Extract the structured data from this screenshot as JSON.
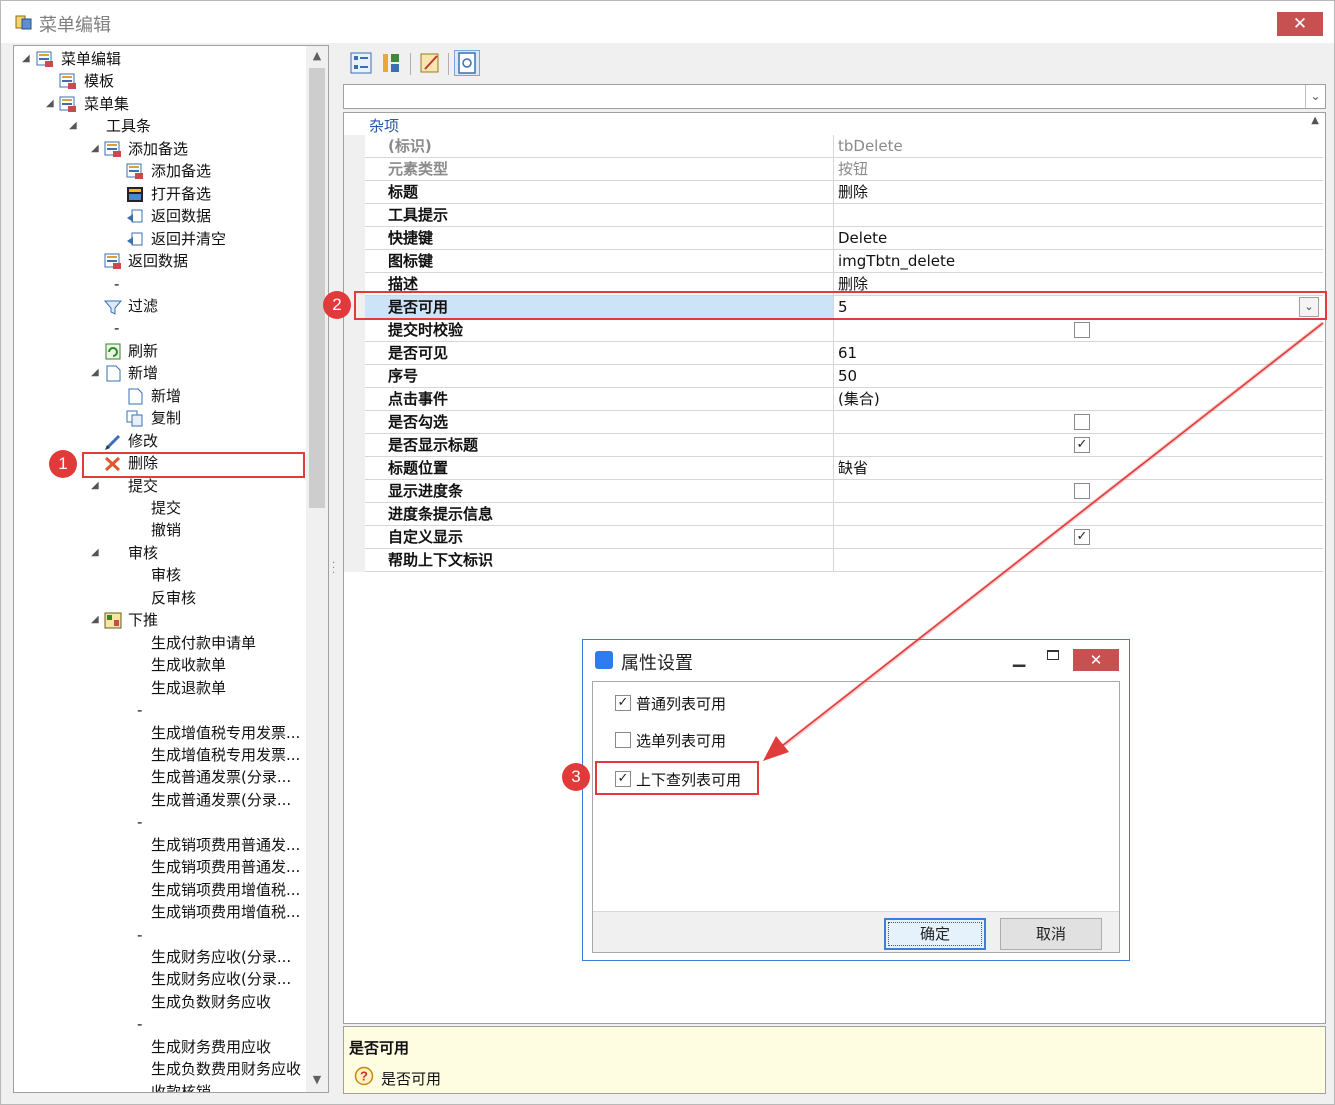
{
  "window": {
    "title": "菜单编辑",
    "close_glyph": "✕"
  },
  "tree": {
    "nodes": [
      {
        "label": "菜单编辑",
        "icon": "menu-editor-icon"
      },
      {
        "label": "模板",
        "icon": "menu-editor-icon"
      },
      {
        "label": "菜单集",
        "icon": "menu-editor-icon"
      },
      {
        "label": "工具条",
        "icon": ""
      },
      {
        "label": "添加备选",
        "icon": "menu-editor-icon"
      },
      {
        "label": "添加备选",
        "icon": "menu-editor-icon"
      },
      {
        "label": "打开备选",
        "icon": "open-icon"
      },
      {
        "label": "返回数据",
        "icon": "return-icon"
      },
      {
        "label": "返回并清空",
        "icon": "return-icon"
      },
      {
        "label": "返回数据",
        "icon": "menu-editor-icon"
      },
      {
        "label": "-",
        "icon": ""
      },
      {
        "label": "过滤",
        "icon": "filter-icon"
      },
      {
        "label": "-",
        "icon": ""
      },
      {
        "label": "刷新",
        "icon": "refresh-icon"
      },
      {
        "label": "新增",
        "icon": "new-doc-icon"
      },
      {
        "label": "新增",
        "icon": "new-doc-icon"
      },
      {
        "label": "复制",
        "icon": "copy-icon"
      },
      {
        "label": "修改",
        "icon": "edit-icon"
      },
      {
        "label": "删除",
        "icon": "delete-icon"
      },
      {
        "label": "提交",
        "icon": ""
      },
      {
        "label": "提交",
        "icon": ""
      },
      {
        "label": "撤销",
        "icon": ""
      },
      {
        "label": "审核",
        "icon": ""
      },
      {
        "label": "审核",
        "icon": ""
      },
      {
        "label": "反审核",
        "icon": ""
      },
      {
        "label": "下推",
        "icon": "push-down-icon"
      },
      {
        "label": "生成付款申请单",
        "icon": ""
      },
      {
        "label": "生成收款单",
        "icon": ""
      },
      {
        "label": "生成退款单",
        "icon": ""
      },
      {
        "label": "-",
        "icon": ""
      },
      {
        "label": "生成增值税专用发票...",
        "icon": ""
      },
      {
        "label": "生成增值税专用发票...",
        "icon": ""
      },
      {
        "label": "生成普通发票(分录...",
        "icon": ""
      },
      {
        "label": "生成普通发票(分录...",
        "icon": ""
      },
      {
        "label": "-",
        "icon": ""
      },
      {
        "label": "生成销项费用普通发...",
        "icon": ""
      },
      {
        "label": "生成销项费用普通发...",
        "icon": ""
      },
      {
        "label": "生成销项费用增值税...",
        "icon": ""
      },
      {
        "label": "生成销项费用增值税...",
        "icon": ""
      },
      {
        "label": "-",
        "icon": ""
      },
      {
        "label": "生成财务应收(分录...",
        "icon": ""
      },
      {
        "label": "生成财务应收(分录...",
        "icon": ""
      },
      {
        "label": "生成负数财务应收",
        "icon": ""
      },
      {
        "label": "-",
        "icon": ""
      },
      {
        "label": "生成财务费用应收",
        "icon": ""
      },
      {
        "label": "生成负数费用财务应收",
        "icon": ""
      },
      {
        "label": "收款核销",
        "icon": ""
      }
    ]
  },
  "toolbar": {
    "buttons": [
      "categorized-icon",
      "sort-alpha-icon",
      "property-pages-icon",
      "properties-icon"
    ]
  },
  "property_grid": {
    "object_combo_value": "",
    "category": "杂项",
    "rows": [
      {
        "name": "(标识)",
        "value": "tbDelete",
        "readonly": true
      },
      {
        "name": "元素类型",
        "value": "按钮",
        "readonly": true
      },
      {
        "name": "标题",
        "value": "删除"
      },
      {
        "name": "工具提示",
        "value": ""
      },
      {
        "name": "快捷键",
        "value": "Delete"
      },
      {
        "name": "图标键",
        "value": "imgTbtn_delete"
      },
      {
        "name": "描述",
        "value": "删除"
      },
      {
        "name": "是否可用",
        "value": "5",
        "selected": true
      },
      {
        "name": "提交时校验",
        "value": "",
        "checkbox": false
      },
      {
        "name": "是否可见",
        "value": "61"
      },
      {
        "name": "序号",
        "value": "50"
      },
      {
        "name": "点击事件",
        "value": "(集合)"
      },
      {
        "name": "是否勾选",
        "value": "",
        "checkbox": false
      },
      {
        "name": "是否显示标题",
        "value": "",
        "checkbox": true
      },
      {
        "name": "标题位置",
        "value": "缺省"
      },
      {
        "name": "显示进度条",
        "value": "",
        "checkbox": false
      },
      {
        "name": "进度条提示信息",
        "value": ""
      },
      {
        "name": "自定义显示",
        "value": "",
        "checkbox": true
      },
      {
        "name": "帮助上下文标识",
        "value": ""
      }
    ]
  },
  "help": {
    "title": "是否可用",
    "description": "是否可用"
  },
  "dialog": {
    "title": "属性设置",
    "options": [
      {
        "label": "普通列表可用",
        "checked": true
      },
      {
        "label": "选单列表可用",
        "checked": false
      },
      {
        "label": "上下查列表可用",
        "checked": true
      }
    ],
    "ok_label": "确定",
    "cancel_label": "取消"
  },
  "annotations": {
    "badge1": "1",
    "badge2": "2",
    "badge3": "3",
    "accent": "#e03c3c"
  },
  "glyphs": {
    "check": "✓",
    "dropdown": "⌄",
    "scroll_up": "▲",
    "scroll_down": "▼",
    "close": "✕",
    "minimize": "▁"
  }
}
